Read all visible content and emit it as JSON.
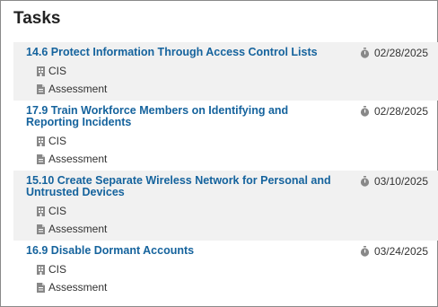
{
  "panel": {
    "title": "Tasks"
  },
  "tasks": [
    {
      "title": "14.6 Protect Information Through Access Control Lists",
      "framework": "CIS",
      "type": "Assessment",
      "due_date": "02/28/2025"
    },
    {
      "title": "17.9 Train Workforce Members on Identifying and Reporting Incidents",
      "framework": "CIS",
      "type": "Assessment",
      "due_date": "02/28/2025"
    },
    {
      "title": "15.10 Create Separate Wireless Network for Personal and Untrusted Devices",
      "framework": "CIS",
      "type": "Assessment",
      "due_date": "03/10/2025"
    },
    {
      "title": "16.9 Disable Dormant Accounts",
      "framework": "CIS",
      "type": "Assessment",
      "due_date": "03/24/2025"
    }
  ],
  "icons": {
    "framework": "building-icon",
    "type": "document-icon",
    "due": "stopwatch-icon"
  },
  "colors": {
    "link": "#15639d",
    "row_shade": "#f1f1f1",
    "icon": "#888888"
  }
}
